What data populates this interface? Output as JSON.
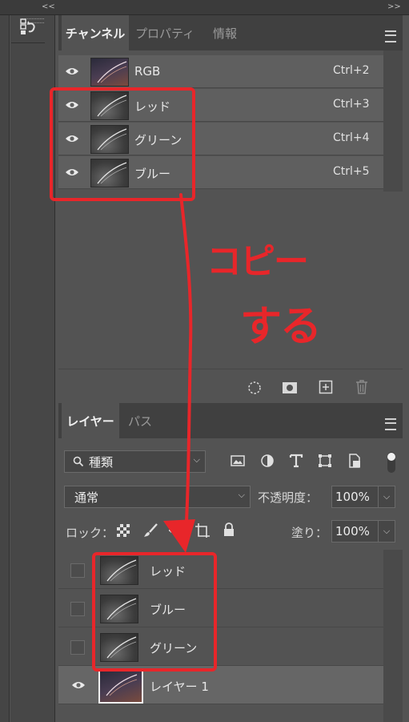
{
  "collapse_left": "<<",
  "collapse_right": ">>",
  "channels_panel": {
    "tabs": [
      "チャンネル",
      "プロパティ",
      "情報"
    ],
    "rows": [
      {
        "name": "RGB",
        "shortcut": "Ctrl+2",
        "thumb": "rgb"
      },
      {
        "name": "レッド",
        "shortcut": "Ctrl+3",
        "thumb": "gray"
      },
      {
        "name": "グリーン",
        "shortcut": "Ctrl+4",
        "thumb": "gray"
      },
      {
        "name": "ブルー",
        "shortcut": "Ctrl+5",
        "thumb": "gray"
      }
    ],
    "bottom_icons": [
      "selection-circle-icon",
      "mask-icon",
      "new-channel-icon",
      "trash-icon"
    ]
  },
  "annotation": {
    "line1": "コピー",
    "line2": "する",
    "color": "#e8262a"
  },
  "layers_panel": {
    "tabs": [
      "レイヤー",
      "パス"
    ],
    "filter_kind": "種類",
    "filter_icons": [
      "image-filter-icon",
      "adjustment-filter-icon",
      "type-filter-icon",
      "shape-filter-icon",
      "smart-object-filter-icon"
    ],
    "blend_mode": "通常",
    "opacity_label": "不透明度：",
    "opacity_value": "100%",
    "lock_label": "ロック：",
    "fill_label": "塗り：",
    "fill_value": "100%",
    "layers": [
      {
        "name": "レッド",
        "visible": false,
        "thumb": "gray"
      },
      {
        "name": "ブルー",
        "visible": false,
        "thumb": "gray"
      },
      {
        "name": "グリーン",
        "visible": false,
        "thumb": "gray"
      },
      {
        "name": "レイヤー 1",
        "visible": true,
        "thumb": "rgb"
      }
    ]
  }
}
